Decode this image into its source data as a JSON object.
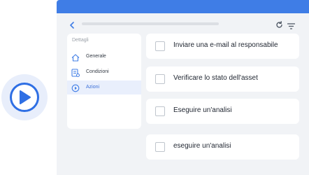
{
  "sidebar": {
    "title": "Dettagli",
    "items": [
      {
        "label": "Generale",
        "icon": "home-icon",
        "active": false
      },
      {
        "label": "Condizioni",
        "icon": "conditions-list-icon",
        "active": false
      },
      {
        "label": "Azioni",
        "icon": "play-circle-icon",
        "active": true
      }
    ]
  },
  "tasks": [
    {
      "label": "Inviare una e-mail al responsabile",
      "checked": false
    },
    {
      "label": "Verificare lo stato dell'asset",
      "checked": false
    },
    {
      "label": "Eseguire un'analisi",
      "checked": false
    },
    {
      "label": "eseguire un'analisi",
      "checked": false
    }
  ],
  "colors": {
    "titlebar": "#3f7de6",
    "accent": "#2f6fe4",
    "active_item_bg": "#e9effc",
    "window_bg": "#f1f3f6"
  }
}
